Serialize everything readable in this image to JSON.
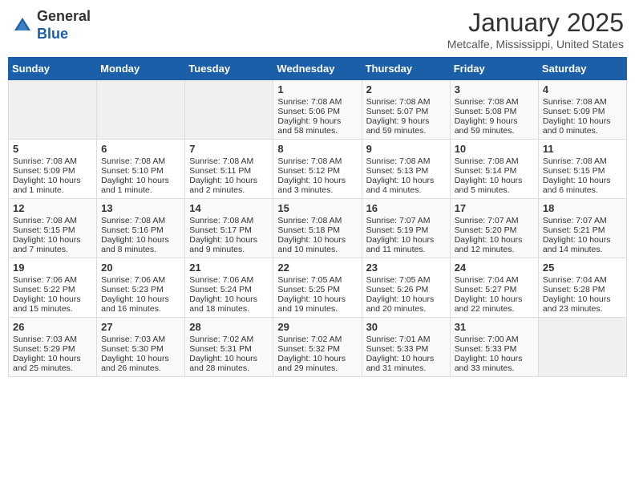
{
  "header": {
    "logo_general": "General",
    "logo_blue": "Blue",
    "month": "January 2025",
    "location": "Metcalfe, Mississippi, United States"
  },
  "weekdays": [
    "Sunday",
    "Monday",
    "Tuesday",
    "Wednesday",
    "Thursday",
    "Friday",
    "Saturday"
  ],
  "weeks": [
    [
      {
        "day": "",
        "info": ""
      },
      {
        "day": "",
        "info": ""
      },
      {
        "day": "",
        "info": ""
      },
      {
        "day": "1",
        "info": "Sunrise: 7:08 AM\nSunset: 5:06 PM\nDaylight: 9 hours and 58 minutes."
      },
      {
        "day": "2",
        "info": "Sunrise: 7:08 AM\nSunset: 5:07 PM\nDaylight: 9 hours and 59 minutes."
      },
      {
        "day": "3",
        "info": "Sunrise: 7:08 AM\nSunset: 5:08 PM\nDaylight: 9 hours and 59 minutes."
      },
      {
        "day": "4",
        "info": "Sunrise: 7:08 AM\nSunset: 5:09 PM\nDaylight: 10 hours and 0 minutes."
      }
    ],
    [
      {
        "day": "5",
        "info": "Sunrise: 7:08 AM\nSunset: 5:09 PM\nDaylight: 10 hours and 1 minute."
      },
      {
        "day": "6",
        "info": "Sunrise: 7:08 AM\nSunset: 5:10 PM\nDaylight: 10 hours and 1 minute."
      },
      {
        "day": "7",
        "info": "Sunrise: 7:08 AM\nSunset: 5:11 PM\nDaylight: 10 hours and 2 minutes."
      },
      {
        "day": "8",
        "info": "Sunrise: 7:08 AM\nSunset: 5:12 PM\nDaylight: 10 hours and 3 minutes."
      },
      {
        "day": "9",
        "info": "Sunrise: 7:08 AM\nSunset: 5:13 PM\nDaylight: 10 hours and 4 minutes."
      },
      {
        "day": "10",
        "info": "Sunrise: 7:08 AM\nSunset: 5:14 PM\nDaylight: 10 hours and 5 minutes."
      },
      {
        "day": "11",
        "info": "Sunrise: 7:08 AM\nSunset: 5:15 PM\nDaylight: 10 hours and 6 minutes."
      }
    ],
    [
      {
        "day": "12",
        "info": "Sunrise: 7:08 AM\nSunset: 5:15 PM\nDaylight: 10 hours and 7 minutes."
      },
      {
        "day": "13",
        "info": "Sunrise: 7:08 AM\nSunset: 5:16 PM\nDaylight: 10 hours and 8 minutes."
      },
      {
        "day": "14",
        "info": "Sunrise: 7:08 AM\nSunset: 5:17 PM\nDaylight: 10 hours and 9 minutes."
      },
      {
        "day": "15",
        "info": "Sunrise: 7:08 AM\nSunset: 5:18 PM\nDaylight: 10 hours and 10 minutes."
      },
      {
        "day": "16",
        "info": "Sunrise: 7:07 AM\nSunset: 5:19 PM\nDaylight: 10 hours and 11 minutes."
      },
      {
        "day": "17",
        "info": "Sunrise: 7:07 AM\nSunset: 5:20 PM\nDaylight: 10 hours and 12 minutes."
      },
      {
        "day": "18",
        "info": "Sunrise: 7:07 AM\nSunset: 5:21 PM\nDaylight: 10 hours and 14 minutes."
      }
    ],
    [
      {
        "day": "19",
        "info": "Sunrise: 7:06 AM\nSunset: 5:22 PM\nDaylight: 10 hours and 15 minutes."
      },
      {
        "day": "20",
        "info": "Sunrise: 7:06 AM\nSunset: 5:23 PM\nDaylight: 10 hours and 16 minutes."
      },
      {
        "day": "21",
        "info": "Sunrise: 7:06 AM\nSunset: 5:24 PM\nDaylight: 10 hours and 18 minutes."
      },
      {
        "day": "22",
        "info": "Sunrise: 7:05 AM\nSunset: 5:25 PM\nDaylight: 10 hours and 19 minutes."
      },
      {
        "day": "23",
        "info": "Sunrise: 7:05 AM\nSunset: 5:26 PM\nDaylight: 10 hours and 20 minutes."
      },
      {
        "day": "24",
        "info": "Sunrise: 7:04 AM\nSunset: 5:27 PM\nDaylight: 10 hours and 22 minutes."
      },
      {
        "day": "25",
        "info": "Sunrise: 7:04 AM\nSunset: 5:28 PM\nDaylight: 10 hours and 23 minutes."
      }
    ],
    [
      {
        "day": "26",
        "info": "Sunrise: 7:03 AM\nSunset: 5:29 PM\nDaylight: 10 hours and 25 minutes."
      },
      {
        "day": "27",
        "info": "Sunrise: 7:03 AM\nSunset: 5:30 PM\nDaylight: 10 hours and 26 minutes."
      },
      {
        "day": "28",
        "info": "Sunrise: 7:02 AM\nSunset: 5:31 PM\nDaylight: 10 hours and 28 minutes."
      },
      {
        "day": "29",
        "info": "Sunrise: 7:02 AM\nSunset: 5:32 PM\nDaylight: 10 hours and 29 minutes."
      },
      {
        "day": "30",
        "info": "Sunrise: 7:01 AM\nSunset: 5:33 PM\nDaylight: 10 hours and 31 minutes."
      },
      {
        "day": "31",
        "info": "Sunrise: 7:00 AM\nSunset: 5:33 PM\nDaylight: 10 hours and 33 minutes."
      },
      {
        "day": "",
        "info": ""
      }
    ]
  ]
}
